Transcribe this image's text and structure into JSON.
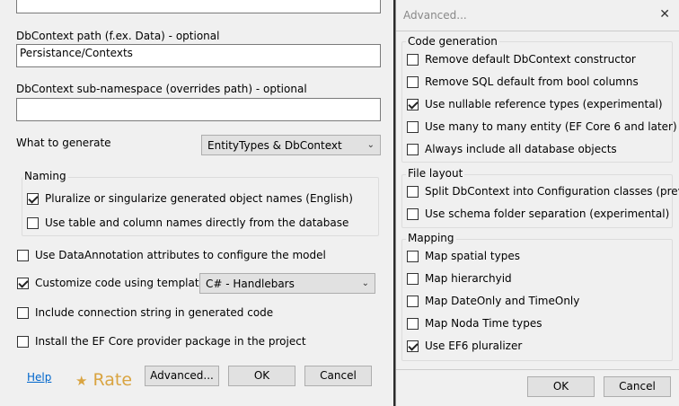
{
  "main": {
    "path_label": "DbContext path (f.ex. Data) - optional",
    "path_value": "Persistance/Contexts",
    "namespace_label": "DbContext sub-namespace (overrides path) - optional",
    "namespace_value": "",
    "generate_label": "What to generate",
    "generate_selected": "EntityTypes & DbContext",
    "naming_title": "Naming",
    "pluralize_label": "Pluralize or singularize generated object names (English)",
    "use_db_names_label": "Use table and column names directly from the database",
    "data_annotation_label": "Use DataAnnotation attributes to configure the model",
    "customize_label": "Customize code using templates",
    "template_selected": "C# - Handlebars",
    "conn_string_label": "Include connection string in generated code",
    "install_label": "Install the EF Core provider package in the project",
    "help_link": "Help",
    "rate_label": "Rate",
    "advanced_button": "Advanced...",
    "ok_button": "OK",
    "cancel_button": "Cancel"
  },
  "advanced": {
    "title": "Advanced...",
    "code_gen_title": "Code generation",
    "remove_ctor": "Remove default DbContext constructor",
    "remove_sql_default": "Remove SQL default from bool columns",
    "nullable_refs": "Use nullable reference types (experimental)",
    "many_to_many": "Use many to many entity (EF Core 6 and later)",
    "include_all": "Always include all database objects",
    "file_layout_title": "File layout",
    "split_config": "Split DbContext into Configuration classes (preview)",
    "schema_folders": "Use schema folder separation (experimental)",
    "mapping_title": "Mapping",
    "spatial": "Map spatial types",
    "hierarchyid": "Map hierarchyid",
    "dateonly": "Map DateOnly and TimeOnly",
    "noda": "Map Noda Time types",
    "ef6": "Use EF6 pluralizer",
    "ok_button": "OK",
    "cancel_button": "Cancel"
  }
}
